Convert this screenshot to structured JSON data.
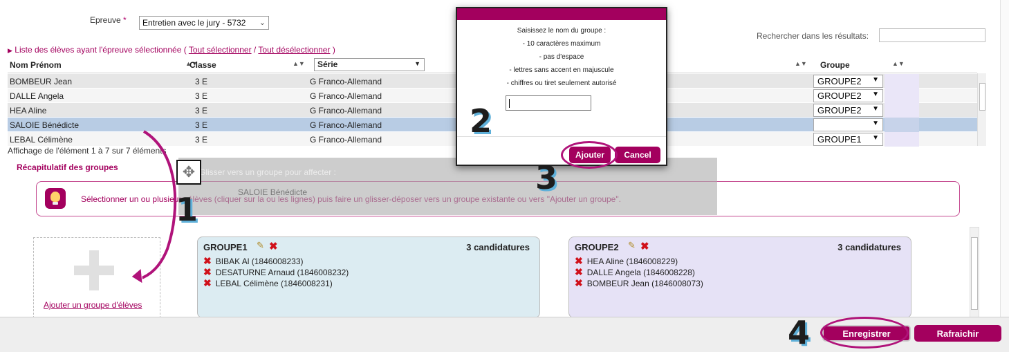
{
  "epreuve": {
    "label": "Epreuve",
    "required_mark": "*",
    "value": "Entretien avec le jury - 5732"
  },
  "search": {
    "label": "Rechercher dans les résultats:"
  },
  "list_header": {
    "prefix": "Liste des élèves ayant l'épreuve sélectionnée (",
    "select_all": "Tout sélectionner",
    "separator": "/",
    "deselect_all": "Tout désélectionner",
    "suffix": ")"
  },
  "table": {
    "columns": {
      "name": "Nom Prénom",
      "classe": "Classe",
      "serie": "Série",
      "groupe": "Groupe"
    },
    "rows": [
      {
        "name": "BOMBEUR Jean",
        "classe": "3 E",
        "serie": "G Franco-Allemand",
        "groupe": "GROUPE2"
      },
      {
        "name": "DALLE Angela",
        "classe": "3 E",
        "serie": "G Franco-Allemand",
        "groupe": "GROUPE2"
      },
      {
        "name": "HEA Aline",
        "classe": "3 E",
        "serie": "G Franco-Allemand",
        "groupe": "GROUPE2"
      },
      {
        "name": "SALOIE Bénédicte",
        "classe": "3 E",
        "serie": "G Franco-Allemand",
        "groupe": ""
      },
      {
        "name": "LEBAL Célimène",
        "classe": "3 E",
        "serie": "G Franco-Allemand",
        "groupe": "GROUPE1"
      }
    ],
    "affichage": "Affichage de l'élément 1 à 7 sur 7 éléments"
  },
  "recap": {
    "title": "Récapitulatif des groupes"
  },
  "info": {
    "text": "Sélectionner un ou plusieurs élèves (cliquer sur la ou les lignes) puis faire un glisser-déposer vers un groupe existante ou vers \"Ajouter un groupe\"."
  },
  "drag": {
    "hint": "Glisser vers un groupe pour affecter :",
    "student": "SALOIE Bénédicte"
  },
  "add_group": {
    "link": "Ajouter un groupe d'élèves"
  },
  "groups": [
    {
      "name": "GROUPE1",
      "count": "3 candidatures",
      "members": [
        "BIBAK Al (1846008233)",
        "DESATURNE Arnaud (1846008232)",
        "LEBAL Célimène (1846008231)"
      ]
    },
    {
      "name": "GROUPE2",
      "count": "3 candidatures",
      "members": [
        "HEA Aline (1846008229)",
        "DALLE Angela (1846008228)",
        "BOMBEUR Jean (1846008073)"
      ]
    }
  ],
  "modal": {
    "lines": [
      "Saisissez le nom du groupe :",
      "- 10 caractères maximum",
      "- pas d'espace",
      "- lettres sans accent en majuscule",
      "- chiffres ou tiret seulement autorisé"
    ],
    "add": "Ajouter",
    "cancel": "Cancel"
  },
  "footer": {
    "save": "Enregistrer",
    "refresh": "Rafraichir"
  },
  "annotations": [
    "1",
    "2",
    "3",
    "4"
  ],
  "colors": {
    "brand": "#a3005e",
    "selected_row": "#b8cce4",
    "group1_bg": "#dcecf2",
    "group2_bg": "#e6e2f6",
    "delete": "#d0101a"
  },
  "icons": [
    "move-icon",
    "lightbulb-icon",
    "pencil-icon",
    "delete-x-icon",
    "plus-icon",
    "sort-icon",
    "chevron-down-icon"
  ]
}
